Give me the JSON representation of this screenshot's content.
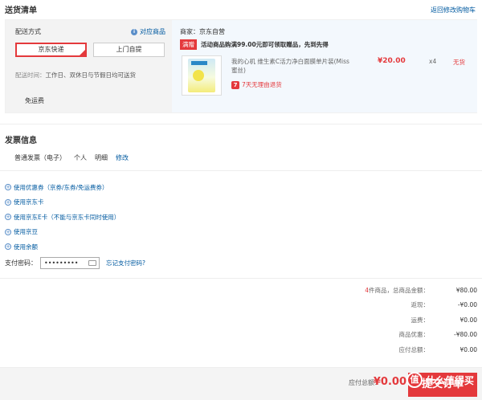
{
  "header": {
    "title": "送货清单",
    "back_link": "返回修改购物车"
  },
  "delivery": {
    "method_label": "配送方式",
    "match_link": "对应商品",
    "options": [
      "京东快递",
      "上门自提"
    ],
    "ship_time_label": "配送时间：",
    "ship_time_value": "工作日、双休日与节假日均可送货",
    "free_shipping": "免运费"
  },
  "merchant": {
    "label": "商家：京东自营",
    "promo_tag": "满赠",
    "promo_text": "活动商品购满99.00元即可领取赠品，先到先得",
    "product_name": "我的心机 维生素C活力净白面膜单片装(Miss蜜丝)",
    "return_icon": "7",
    "return_text": "7天无理由退货",
    "price": "¥20.00",
    "qty": "x4",
    "stock": "无货"
  },
  "invoice": {
    "title": "发票信息",
    "type": "普通发票（电子）",
    "person": "个人",
    "detail": "明细",
    "edit": "修改"
  },
  "coupons": [
    "使用优惠券（京券/东券/免运费券）",
    "使用京东卡",
    "使用京东E卡（不能与京东卡同时使用）",
    "使用京豆",
    "使用余额"
  ],
  "payment": {
    "label": "支付密码：",
    "value": "•••••••••",
    "forgot": "忘记支付密码?"
  },
  "summary": {
    "count": "4",
    "count_text": "件商品，总商品金额：",
    "total_goods": "¥80.00",
    "rebate_label": "返现：",
    "rebate": "-¥0.00",
    "shipping_label": "运费：",
    "shipping": "¥0.00",
    "discount_label": "商品优惠：",
    "discount": "-¥80.00",
    "due_label": "应付总额：",
    "due": "¥0.00"
  },
  "bottom": {
    "total_label": "应付总额：",
    "total_value": "¥0.00",
    "submit": "提交订单"
  },
  "watermark": {
    "logo": "值",
    "text": "什么值得买"
  }
}
